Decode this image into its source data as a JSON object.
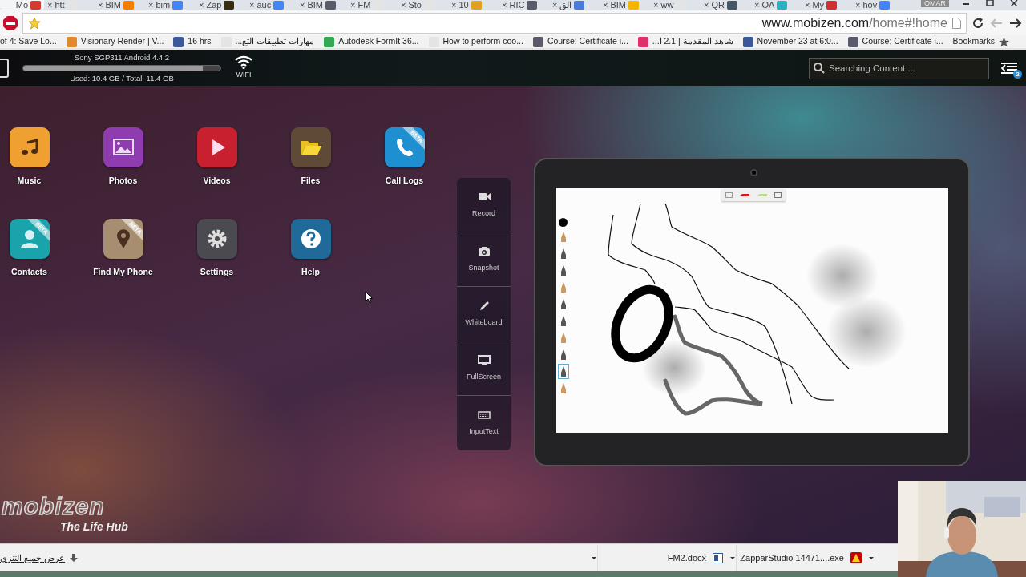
{
  "browser": {
    "tabs": [
      {
        "title": "Mo",
        "color": "#d63a2f",
        "selected": true
      },
      {
        "close": "×",
        "title": "htt",
        "color": "#e4e4e4",
        "selected": false
      },
      {
        "close": "×",
        "title": "BIM",
        "color": "#f57d00",
        "selected": false
      },
      {
        "close": "×",
        "title": "bim",
        "color": "#4285f4",
        "selected": false
      },
      {
        "close": "×",
        "title": "Zap",
        "color": "#3a2a10",
        "selected": false
      },
      {
        "close": "×",
        "title": "auc",
        "color": "#4285f4",
        "selected": false
      },
      {
        "close": "×",
        "title": "BIM",
        "color": "#5a5a6a",
        "selected": false
      },
      {
        "close": "×",
        "title": "FM",
        "color": "#e4e4e4",
        "selected": false
      },
      {
        "close": "×",
        "title": "Sto",
        "color": "#e4e4e4",
        "selected": false
      },
      {
        "close": "×",
        "title": "10",
        "color": "#e0a020",
        "selected": false
      },
      {
        "close": "×",
        "title": "RIC",
        "color": "#5a5a6a",
        "selected": false
      },
      {
        "close": "×",
        "title": "الق",
        "color": "#4a7bd6",
        "selected": false
      },
      {
        "close": "×",
        "title": "BIM",
        "color": "#f4b400",
        "selected": false
      },
      {
        "close": "×",
        "title": "ww",
        "color": "#e4e4e4",
        "selected": false
      },
      {
        "close": "×",
        "title": "QR",
        "color": "#445566",
        "selected": false
      },
      {
        "close": "×",
        "title": "OA",
        "color": "#2ab0c0",
        "selected": false
      },
      {
        "close": "×",
        "title": "My",
        "color": "#d03030",
        "selected": false
      },
      {
        "close": "×",
        "title": "hov",
        "color": "#4285f4",
        "selected": false
      }
    ],
    "profile": "OMAR",
    "address": {
      "host": "www.mobizen.com",
      "path": "/home#!home"
    },
    "bookmarks": [
      {
        "label": "of 4: Save Lo..."
      },
      {
        "label": "Visionary Render | V...",
        "color": "#e08a30"
      },
      {
        "label": "16 hrs",
        "color": "#3b5998"
      },
      {
        "label": "مهارات تطبيقات التع...",
        "color": "#e4e4e4"
      },
      {
        "label": "Autodesk FormIt 36...",
        "color": "#34a853"
      },
      {
        "label": "How to perform coo...",
        "color": "#e4e4e4"
      },
      {
        "label": "Course: Certificate i...",
        "color": "#5a5a6a"
      },
      {
        "label": "شاهد المقدمة | 2.1 ا...",
        "color": "#e0306a"
      },
      {
        "label": "November 23 at 6:0...",
        "color": "#3b5998"
      },
      {
        "label": "Course: Certificate i...",
        "color": "#5a5a6a"
      },
      {
        "label": "Bookmarks",
        "kind": "folder"
      }
    ]
  },
  "device": {
    "name": "Sony SGP311 Android 4.4.2",
    "storage": {
      "level": 0.91,
      "reading": "Used: 10.4 GB / Total: 11.4 GB"
    },
    "network": "WIFI"
  },
  "search": {
    "placeholder": "Searching Content ..."
  },
  "menu_badge": "2",
  "apps": [
    {
      "label": "Music",
      "kind": "music",
      "color": "#f0a030"
    },
    {
      "label": "Photos",
      "color": "#8e3cb0"
    },
    {
      "label": "Videos",
      "kind": "play",
      "color": "#c8202e"
    },
    {
      "label": "Files",
      "kind": "folder",
      "color": "#5e4a36"
    },
    {
      "label": "Call Logs",
      "kind": "phone",
      "color": "#1e8fd0",
      "badge": "BETA"
    },
    {
      "label": "Contacts",
      "kind": "person",
      "color": "#1aa3aa",
      "badge": "BETA"
    },
    {
      "label": "Find My Phone",
      "kind": "pin",
      "color": "#a88e70",
      "badge": "BETA"
    },
    {
      "label": "Settings",
      "kind": "gear",
      "color": "#4a4a50"
    },
    {
      "label": "Help",
      "kind": "help",
      "color": "#1f6a98"
    }
  ],
  "tools": [
    {
      "label": "Record",
      "kind": "video"
    },
    {
      "label": "Snapshot",
      "kind": "camera"
    },
    {
      "label": "Whiteboard",
      "kind": "pencil"
    },
    {
      "label": "FullScreen",
      "kind": "monitor"
    },
    {
      "label": "InputText",
      "kind": "keyboard"
    }
  ],
  "whiteboard": {
    "color": "#000000",
    "pen_tools": [
      {
        "selected": false
      },
      {
        "selected": false
      },
      {
        "selected": false
      },
      {
        "selected": false
      },
      {
        "selected": false
      },
      {
        "selected": false
      },
      {
        "selected": false
      },
      {
        "selected": false
      },
      {
        "selected": true
      },
      {
        "selected": false
      }
    ]
  },
  "logo": {
    "name": "mobizen",
    "tagline": "The Life Hub"
  },
  "downloads": {
    "show_all": "عرض جميع التنزي",
    "items": [
      {
        "name": "FM2.docx",
        "kind": "doc"
      },
      {
        "name": "ZapparStudio 14471....exe",
        "kind": "exe"
      }
    ]
  }
}
